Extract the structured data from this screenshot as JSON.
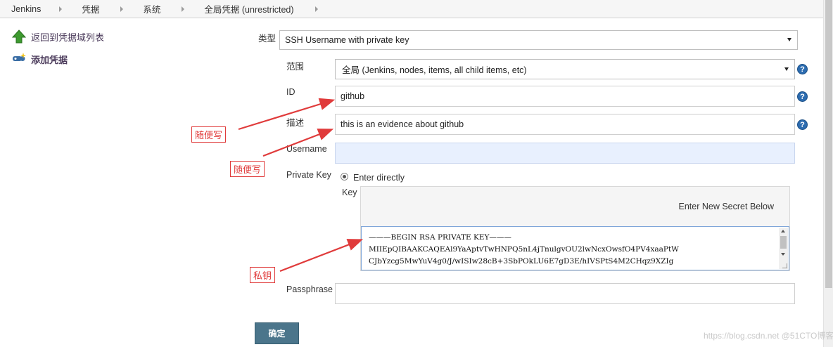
{
  "breadcrumb": [
    "Jenkins",
    "凭据",
    "系统",
    "全局凭据 (unrestricted)"
  ],
  "sidebar": {
    "back_label": "返回到凭据域列表",
    "add_label": "添加凭据"
  },
  "form": {
    "kind_label": "类型",
    "kind_value": "SSH Username with private key",
    "scope_label": "范围",
    "scope_value": "全局 (Jenkins, nodes, items, all child items, etc)",
    "id_label": "ID",
    "id_value": "github",
    "description_label": "描述",
    "description_value": "this is an evidence about github",
    "username_label": "Username",
    "username_value": "",
    "private_key_label": "Private Key",
    "private_key_option": "Enter directly",
    "key_label": "Key",
    "secret_hint": "Enter New Secret Below",
    "key_lines": [
      "———BEGIN RSA PRIVATE KEY———",
      "MIIEpQIBAAKCAQEAl9YaAptvTwHNPQ5nL4jTnulgvOU2lwNcxOwsfO4PV4xaaPtW",
      "CJbYzcg5MwYuV4g0/J/wISIw28cB+3SbPOkLU6E7gD3E/hIVSPtS4M2CHqz9XZIg"
    ],
    "passphrase_label": "Passphrase",
    "passphrase_value": "",
    "help_symbol": "?",
    "submit_label": "确定"
  },
  "annotations": [
    "随便写",
    "随便写",
    "私钥"
  ],
  "annotation_color": "#e03b3b",
  "icons": {
    "back": "green-up-arrow-icon",
    "add": "credentials-key-icon",
    "help": "help-icon",
    "breadcrumb_separator": "caret-right-icon"
  },
  "watermark": "https://blog.csdn.net @51CTO博客"
}
